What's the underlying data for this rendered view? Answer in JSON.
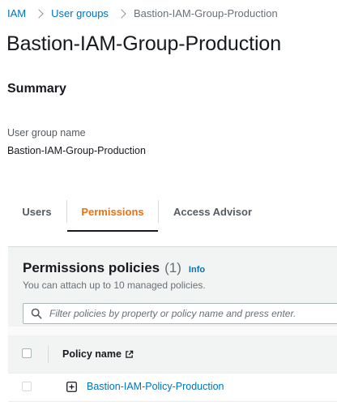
{
  "breadcrumb": {
    "items": [
      {
        "label": "IAM"
      },
      {
        "label": "User groups"
      },
      {
        "label": "Bastion-IAM-Group-Production"
      }
    ]
  },
  "page": {
    "title": "Bastion-IAM-Group-Production"
  },
  "summary": {
    "heading": "Summary",
    "group_name_label": "User group name",
    "group_name_value": "Bastion-IAM-Group-Production"
  },
  "tabs": [
    {
      "label": "Users",
      "active": false
    },
    {
      "label": "Permissions",
      "active": true
    },
    {
      "label": "Access Advisor",
      "active": false
    }
  ],
  "permissions": {
    "title": "Permissions policies",
    "count": "(1)",
    "info_label": "Info",
    "description": "You can attach up to 10 managed policies.",
    "filter_placeholder": "Filter policies by property or policy name and press enter.",
    "columns": {
      "policy_name": "Policy name"
    },
    "rows": [
      {
        "policy_name": "Bastion-IAM-Policy-Production"
      }
    ]
  },
  "colors": {
    "link": "#0073bb",
    "active_tab": "#ec7211",
    "text": "#16191f",
    "muted": "#687078"
  },
  "icons": {
    "breadcrumb_separator": "chevron-right-icon",
    "search": "search-icon",
    "external_link": "external-link-icon",
    "expand": "expand-plus-icon"
  }
}
